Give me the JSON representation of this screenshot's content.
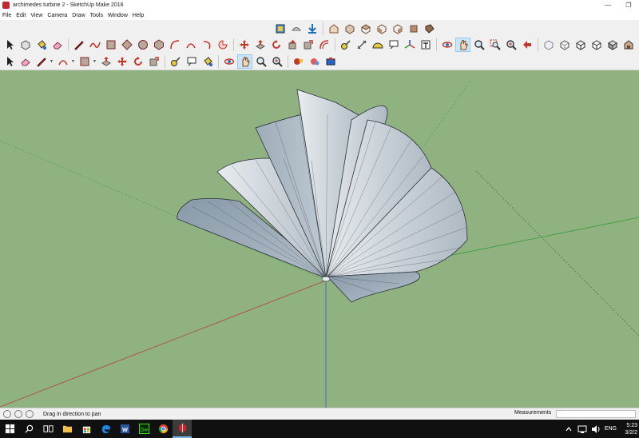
{
  "window": {
    "title": "archimedes turbine 2 - SketchUp Make 2016",
    "app_icon": "sketchup-icon"
  },
  "window_controls": [
    "minimize-icon",
    "maximize-icon"
  ],
  "menu": [
    "File",
    "Edit",
    "View",
    "Camera",
    "Draw",
    "Tools",
    "Window",
    "Help"
  ],
  "toolbars": {
    "row1": [
      "component-icon",
      "3d-warehouse-icon",
      "get-models-icon",
      "share-model-icon",
      "iso-view-icon",
      "top-view-icon",
      "front-view-icon",
      "right-view-icon",
      "back-view-icon",
      "left-view-icon"
    ],
    "row2": [
      "select-icon",
      "make-component-icon",
      "paint-bucket-icon",
      "eraser-icon",
      "pencil-icon",
      "freehand-icon",
      "rectangle-icon",
      "rotated-rectangle-icon",
      "circle-icon",
      "polygon-icon",
      "arc-icon",
      "2pt-arc-icon",
      "3pt-arc-icon",
      "pie-icon",
      "move-icon",
      "push-pull-icon",
      "rotate-icon",
      "follow-me-icon",
      "scale-icon",
      "offset-icon",
      "tape-measure-icon",
      "dimension-icon",
      "protractor-icon",
      "text-icon",
      "axes-icon",
      "3d-text-icon",
      "orbit-icon",
      "pan-icon",
      "zoom-icon",
      "zoom-window-icon",
      "zoom-extents-icon",
      "previous-view-icon",
      "xray-icon",
      "back-edges-icon",
      "wireframe-icon",
      "hidden-line-icon",
      "shaded-icon",
      "shaded-textures-icon",
      "monochrome-icon"
    ],
    "row3": [
      "select-icon",
      "eraser-icon",
      "line-icon",
      "arc-icon",
      "rectangle-icon",
      "push-pull-icon",
      "move-icon",
      "rotate-icon",
      "scale-icon",
      "tape-measure-icon",
      "text-icon",
      "paint-bucket-icon",
      "orbit-icon",
      "pan-icon",
      "zoom-icon",
      "zoom-extents-icon",
      "walk-icon",
      "look-around-icon",
      "position-camera-icon"
    ],
    "active_tool": "pan-icon"
  },
  "status": {
    "hint": "Drag in direction to pan",
    "measurements_label": "Measurements",
    "measurements_value": ""
  },
  "taskbar": {
    "apps": [
      "windows-start-icon",
      "search-icon",
      "file-explorer-icon",
      "store-icon",
      "edge-icon",
      "word-icon",
      "dreamweaver-icon",
      "chrome-icon",
      "sketchup-icon"
    ],
    "dw_label": "Dw",
    "word_label": "W",
    "active_app": "sketchup-icon",
    "language": "ENG",
    "time": "5:23",
    "date": "3/2/2"
  }
}
